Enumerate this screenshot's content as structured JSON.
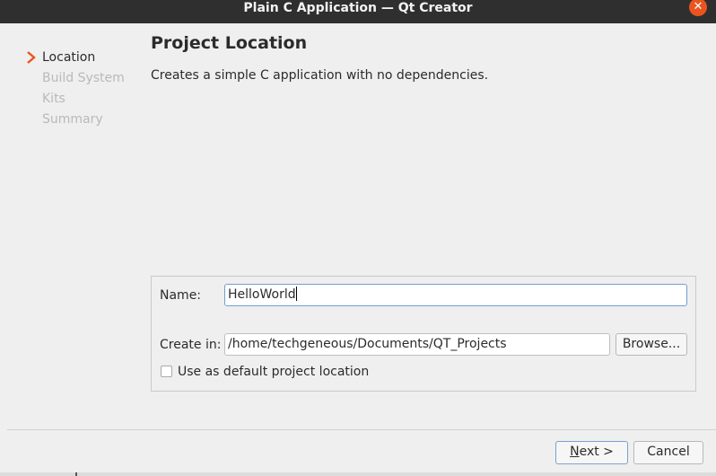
{
  "window": {
    "title": "Plain C Application — Qt Creator",
    "close_glyph": "✕"
  },
  "wizard": {
    "steps": [
      {
        "label": "Location",
        "active": true
      },
      {
        "label": "Build System",
        "active": false
      },
      {
        "label": "Kits",
        "active": false
      },
      {
        "label": "Summary",
        "active": false
      }
    ],
    "current_step_icon": "chevron-right-icon"
  },
  "page": {
    "title": "Project Location",
    "description": "Creates a simple C application with no dependencies."
  },
  "form": {
    "name_label": "Name:",
    "name_value": "HelloWorld",
    "create_in_label": "Create in:",
    "create_in_value": "/home/techgeneous/Documents/QT_Projects",
    "browse_label": "Browse...",
    "default_location_label": "Use as default project location",
    "default_location_checked": false
  },
  "footer": {
    "next_label_mnemonic": "N",
    "next_label_rest": "ext >",
    "cancel_label": "Cancel"
  },
  "colors": {
    "titlebar": "#2f2f2f",
    "close_button": "#e9541f",
    "accent_arrow": "#e9541f",
    "focus_border": "#6f9fd4",
    "inactive_step": "#b9b9b9"
  }
}
